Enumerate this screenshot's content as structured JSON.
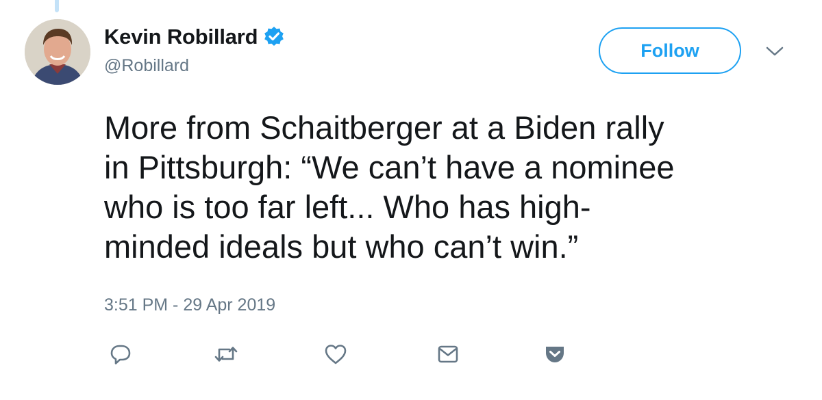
{
  "tweet": {
    "author": {
      "display_name": "Kevin Robillard",
      "handle": "@Robillard",
      "verified": true
    },
    "follow_label": "Follow",
    "text_lines": [
      "More from Schaitberger at a Biden rally",
      "in Pittsburgh: “We can’t have a nominee",
      "who is too far left... Who has high-",
      "minded ideals but who can’t win.”"
    ],
    "timestamp": "3:51 PM - 29 Apr 2019",
    "actions": [
      {
        "name": "reply",
        "icon": "speech-bubble-icon"
      },
      {
        "name": "retweet",
        "icon": "retweet-icon"
      },
      {
        "name": "like",
        "icon": "heart-icon"
      },
      {
        "name": "direct-message",
        "icon": "envelope-icon"
      },
      {
        "name": "pocket",
        "icon": "pocket-icon"
      }
    ]
  },
  "colors": {
    "accent": "#1da1f2",
    "text": "#14171a",
    "secondary_text": "#657786",
    "action_icon": "#657786",
    "pocket": "#657786",
    "thread_line": "#c4e2f8"
  }
}
